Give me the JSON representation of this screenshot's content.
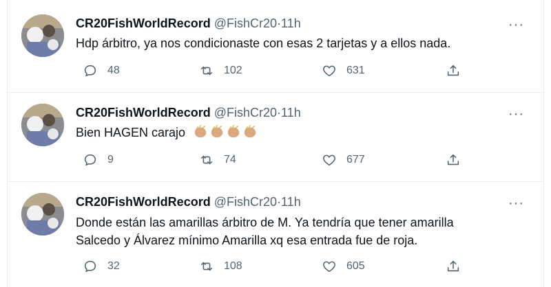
{
  "tweets": [
    {
      "name": "CR20FishWorldRecord",
      "handle": "@FishCr20",
      "separator": "·",
      "time": "11h",
      "more": "···",
      "text": "Hdp árbitro, ya nos condicionaste con esas 2 tarjetas y a ellos nada.",
      "replies": "48",
      "retweets": "102",
      "likes": "631"
    },
    {
      "name": "CR20FishWorldRecord",
      "handle": "@FishCr20",
      "separator": "·",
      "time": "11h",
      "more": "···",
      "text": "Bien HAGEN carajo",
      "emoji": "clapping-hands x4",
      "replies": "9",
      "retweets": "74",
      "likes": "677"
    },
    {
      "name": "CR20FishWorldRecord",
      "handle": "@FishCr20",
      "separator": "·",
      "time": "11h",
      "more": "···",
      "text_line1": "Donde están las amarillas árbitro de M. Ya tendría que tener amarilla",
      "text_line2": "Salcedo y Álvarez mínimo Amarilla xq esa entrada fue de roja.",
      "replies": "32",
      "retweets": "108",
      "likes": "605"
    }
  ],
  "colors": {
    "text": "#0f1419",
    "secondary": "#536471",
    "divider": "#e6ecf0",
    "clap": "#d9a87e"
  }
}
